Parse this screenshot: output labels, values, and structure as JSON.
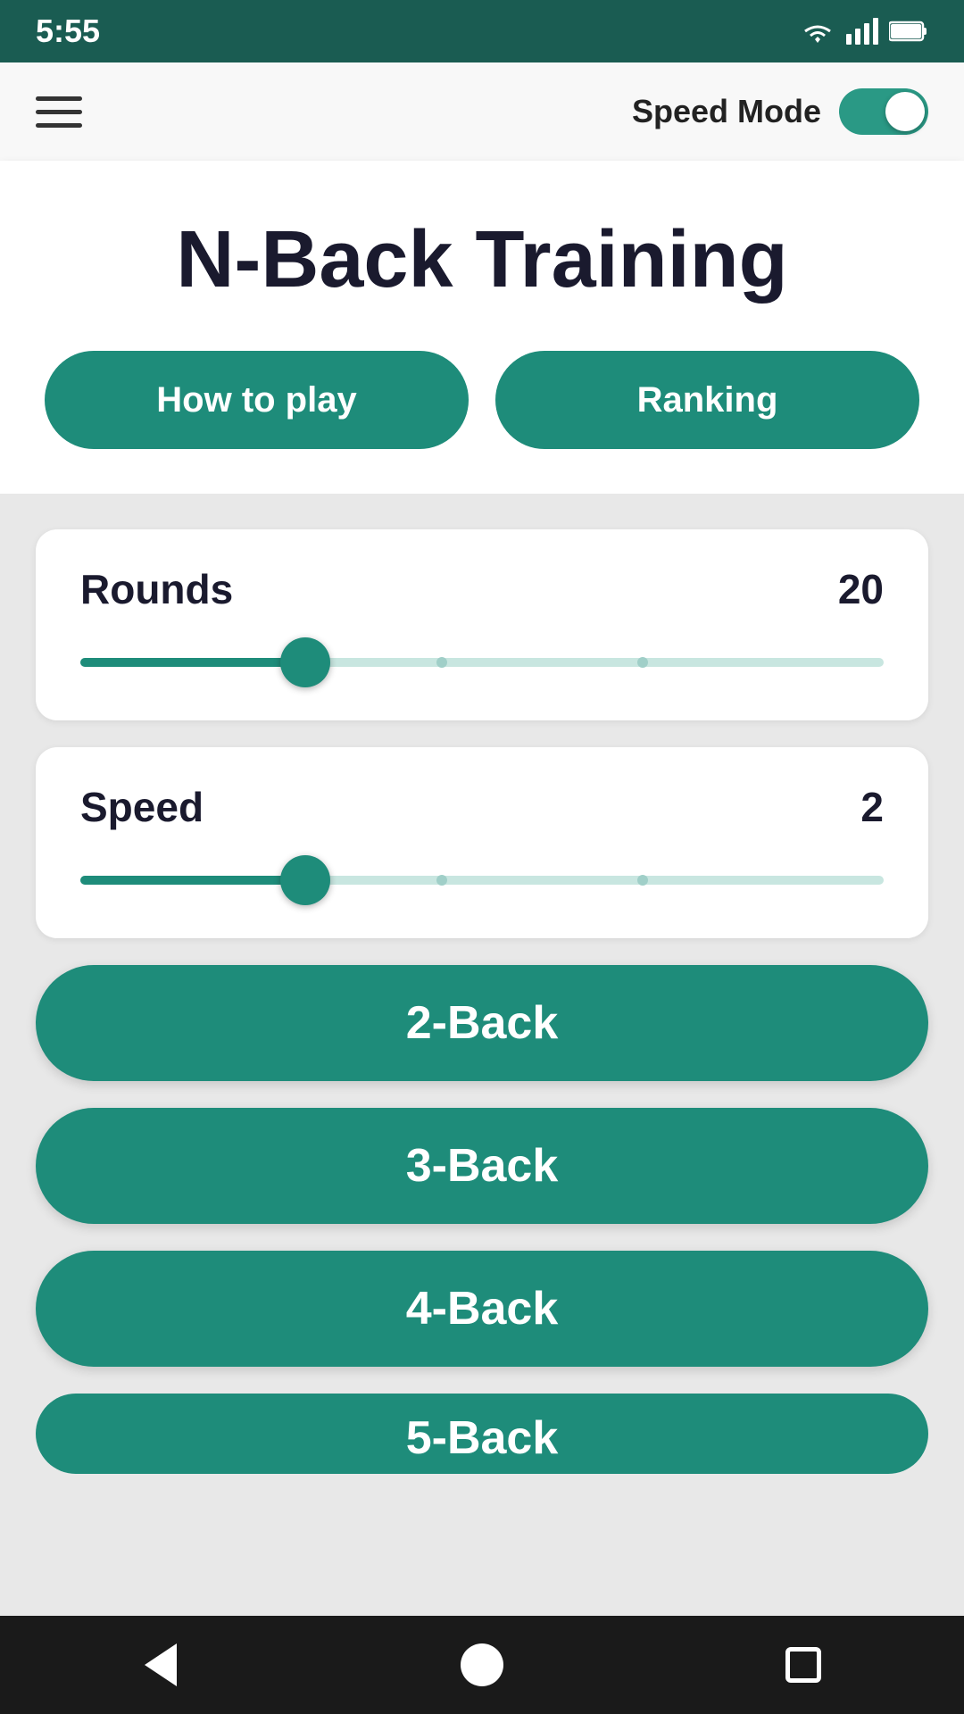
{
  "statusBar": {
    "time": "5:55",
    "wifiIcon": "wifi",
    "signalIcon": "signal",
    "batteryIcon": "battery"
  },
  "appBar": {
    "menuIcon": "hamburger-menu",
    "speedModeLabel": "Speed Mode",
    "toggleEnabled": true
  },
  "header": {
    "title": "N-Back Training",
    "howToPlayLabel": "How to play",
    "rankingLabel": "Ranking"
  },
  "roundsSlider": {
    "label": "Rounds",
    "value": "20",
    "fillPercent": 28,
    "thumbPercent": 27,
    "tick1Percent": 45,
    "tick2Percent": 70
  },
  "speedSlider": {
    "label": "Speed",
    "value": "2",
    "fillPercent": 28,
    "thumbPercent": 27,
    "tick1Percent": 45,
    "tick2Percent": 70
  },
  "gameButtons": [
    {
      "label": "2-Back",
      "id": "2-back"
    },
    {
      "label": "3-Back",
      "id": "3-back"
    },
    {
      "label": "4-Back",
      "id": "4-back"
    },
    {
      "label": "5-Back",
      "id": "5-back"
    }
  ],
  "navBar": {
    "backIcon": "back-arrow",
    "homeIcon": "home-circle",
    "squareIcon": "recent-apps"
  }
}
